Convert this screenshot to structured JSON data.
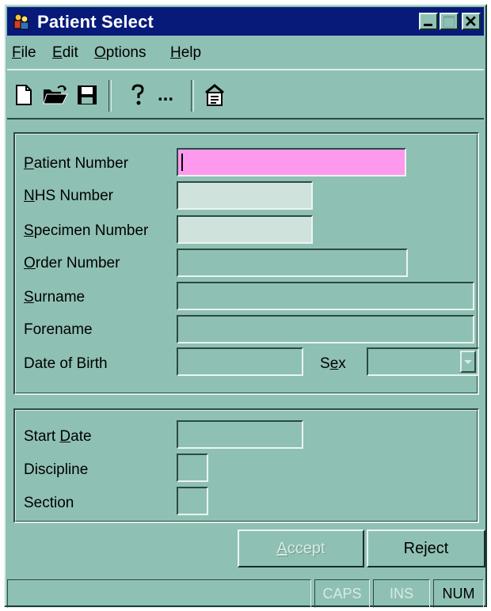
{
  "window": {
    "title": "Patient Select",
    "title_icon": "people-icon",
    "controls": [
      "minimize-icon",
      "maximize-icon",
      "close-icon"
    ]
  },
  "menu": {
    "items": [
      {
        "label": "File",
        "accel": "F"
      },
      {
        "label": "Edit",
        "accel": "E"
      },
      {
        "label": "Options",
        "accel": "O"
      },
      {
        "label": "Help",
        "accel": "H"
      }
    ]
  },
  "toolbar": {
    "icons": [
      "new-document-icon",
      "open-folder-icon",
      "save-disk-icon",
      "help-question-icon",
      "more-ellipsis-icon",
      "properties-icon"
    ],
    "ellipsis": "..."
  },
  "patient_form": {
    "patient_number": {
      "label": "Patient Number",
      "value": ""
    },
    "nhs_number": {
      "label": "NHS Number",
      "value": ""
    },
    "specimen_number": {
      "label": "Specimen Number",
      "value": ""
    },
    "order_number": {
      "label": "Order Number",
      "value": ""
    },
    "surname": {
      "label": "Surname",
      "value": ""
    },
    "forename": {
      "label": "Forename",
      "value": ""
    },
    "date_of_birth": {
      "label": "Date of Birth",
      "value": ""
    },
    "sex": {
      "label": "Sex",
      "value": ""
    }
  },
  "request_form": {
    "start_date": {
      "label": "Start Date",
      "value": ""
    },
    "discipline": {
      "label": "Discipline",
      "value": ""
    },
    "section": {
      "label": "Section",
      "value": ""
    }
  },
  "buttons": {
    "accept": "Accept",
    "reject": "Reject"
  },
  "statusbar": {
    "message": "",
    "caps": "CAPS",
    "ins": "INS",
    "num": "NUM"
  },
  "colors": {
    "window_bg": "#8fc0b4",
    "titlebar": "#071a7a",
    "patient_number_field": "#ff99ee",
    "id_fields": "#cfe3dc"
  }
}
